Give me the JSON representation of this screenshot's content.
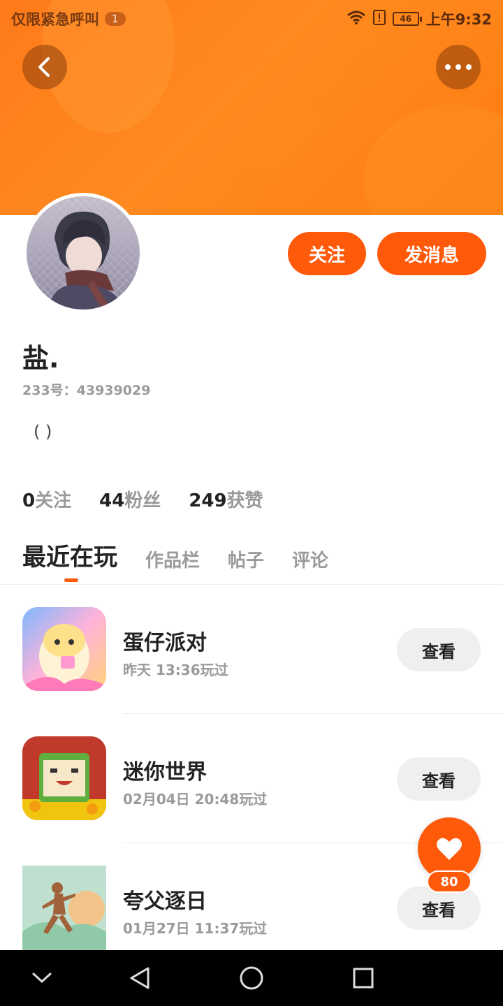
{
  "status_bar": {
    "carrier_text": "仅限紧急呼叫",
    "badge": "1",
    "battery": "46",
    "time": "上午9:32",
    "icons": [
      "wifi-icon",
      "alert-icon",
      "battery-icon"
    ]
  },
  "header": {
    "back_icon": "chevron-left-icon",
    "more_icon": "more-dots-icon",
    "accent_color": "#ff5a0a",
    "banner_color": "#ff7a1a"
  },
  "profile": {
    "name": "盐.",
    "id_text": "233号：43939029",
    "bio": "( )",
    "follow_label": "关注",
    "message_label": "发消息"
  },
  "stats": [
    {
      "num": "0",
      "label": "关注"
    },
    {
      "num": "44",
      "label": "粉丝"
    },
    {
      "num": "249",
      "label": "获赞"
    }
  ],
  "tabs": [
    {
      "label": "最近在玩",
      "active": true
    },
    {
      "label": "作品栏",
      "active": false
    },
    {
      "label": "帖子",
      "active": false
    },
    {
      "label": "评论",
      "active": false
    }
  ],
  "games": [
    {
      "name": "蛋仔派对",
      "time": "昨天 13:36玩过",
      "button": "查看",
      "icon": "eggy-party-icon"
    },
    {
      "name": "迷你世界",
      "time": "02月04日 20:48玩过",
      "button": "查看",
      "icon": "mini-world-icon"
    },
    {
      "name": "夸父逐日",
      "time": "01月27日 11:37玩过",
      "button": "查看",
      "icon": "kuafu-icon"
    }
  ],
  "like": {
    "count": "80",
    "icon": "heart-icon"
  },
  "nav": {
    "icons": [
      "chevron-down-icon",
      "back-triangle-icon",
      "home-circle-icon",
      "recents-square-icon"
    ]
  }
}
